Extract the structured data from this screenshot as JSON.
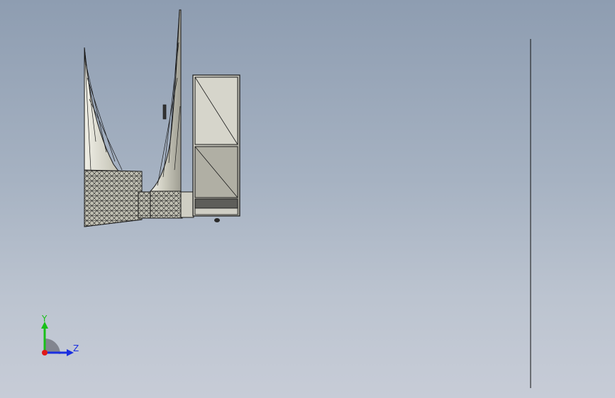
{
  "viewport": {
    "background_top": "#8e9db1",
    "background_bottom": "#c7ccd7"
  },
  "model": {
    "edge_color": "#1a1a1a",
    "face_light": "#d9d8cc",
    "face_mid": "#b7b6a8",
    "face_dark": "#8b8a80"
  },
  "triad": {
    "y_label": "Y",
    "z_label": "Z",
    "y_color": "#18c018",
    "z_color": "#1a2fe0",
    "x_color": "#e01818"
  }
}
